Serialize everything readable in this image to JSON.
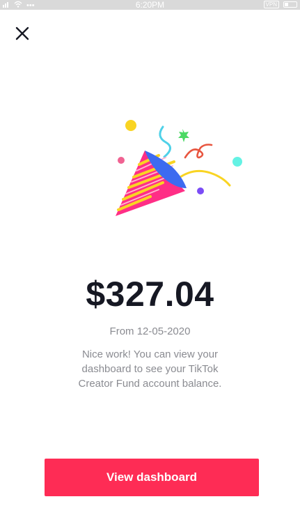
{
  "status_bar": {
    "time": "6:20PM",
    "dots": "•••",
    "vpn_label": "VPN"
  },
  "icons": {
    "close": "close-icon",
    "party_popper": "party-popper-icon",
    "signal": "signal-icon",
    "wifi": "wifi-icon",
    "battery": "battery-icon"
  },
  "main": {
    "amount": "$327.04",
    "date_text": "From 12-05-2020",
    "description": "Nice work! You can view your dashboard to see your TikTok Creator Fund account balance."
  },
  "actions": {
    "view_dashboard_label": "View dashboard"
  },
  "colors": {
    "accent": "#fe2c55",
    "amount_text": "#161823",
    "secondary_text": "#8a8b91"
  }
}
